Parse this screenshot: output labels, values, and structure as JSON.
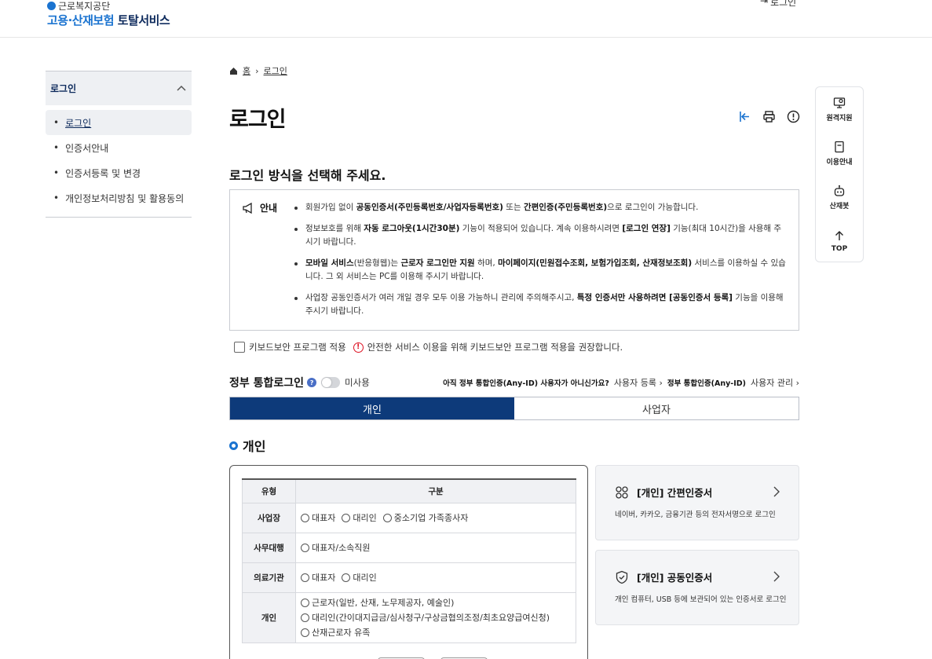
{
  "header": {
    "org": "근로복지공단",
    "brand_a": "고용·산재보험",
    "brand_b": "토탈서비스",
    "logout": "로그인"
  },
  "sidebar": {
    "title": "로그인",
    "items": [
      {
        "label": "로그인"
      },
      {
        "label": "인증서안내"
      },
      {
        "label": "인증서등록 및 변경"
      },
      {
        "label": "개인정보처리방침 및 활용동의"
      }
    ]
  },
  "breadcrumb": [
    "홈",
    "로그인"
  ],
  "page_title": "로그인",
  "section_heading": "로그인 방식을 선택해 주세요.",
  "notice": {
    "label": "안내",
    "items": [
      {
        "parts": [
          {
            "t": "회원가입 없이 ",
            "b": false
          },
          {
            "t": "공동인증서(주민등록번호/사업자등록번호)",
            "b": true
          },
          {
            "t": " 또는 ",
            "b": false
          },
          {
            "t": "간편인증(주민등록번호)",
            "b": true
          },
          {
            "t": "으로 로그인이 가능합니다.",
            "b": false
          }
        ]
      },
      {
        "parts": [
          {
            "t": "정보보호를 위해 ",
            "b": false
          },
          {
            "t": "자동 로그아웃(1시간30분)",
            "b": true
          },
          {
            "t": " 기능이 적용되어 있습니다. 계속 이용하시려면 ",
            "b": false
          },
          {
            "t": "[로그인 연장]",
            "b": true
          },
          {
            "t": " 기능(최대 10시간)을 사용해 주시기 바랍니다.",
            "b": false
          }
        ]
      },
      {
        "parts": [
          {
            "t": "모바일 서비스",
            "b": true
          },
          {
            "t": "(반응형웹)는 ",
            "b": false
          },
          {
            "t": "근로자 로그인만 지원",
            "b": true
          },
          {
            "t": " 하며, ",
            "b": false
          },
          {
            "t": "마이페이지(민원접수조회, 보험가입조회, 산재정보조회)",
            "b": true
          },
          {
            "t": " 서비스를 이용하실 수 있습니다. 그 외 서비스는 PC를 이용해 주시기 바랍니다.",
            "b": false
          }
        ]
      },
      {
        "parts": [
          {
            "t": "사업장 공동인증서가 여러 개일 경우 모두 이용 가능하니 관리에 주의해주시고, ",
            "b": false
          },
          {
            "t": "특정 인증서만 사용하려면 [공동인증서 등록]",
            "b": true
          },
          {
            "t": " 기능을 이용해 주시기 바랍니다.",
            "b": false
          }
        ]
      }
    ]
  },
  "keyboard": {
    "label": "키보드보안 프로그램 적용",
    "warning": "안전한 서비스 이용을 위해 키보드보안 프로그램 적용을 권장합니다."
  },
  "gov_login": {
    "title": "정부 통합로그인",
    "toggle_label": "미사용",
    "question": "아직 정부 통합인증(Any-ID) 사용자가 아니신가요?",
    "register": "사용자 등록",
    "anyid": "정부 통합인증(Any-ID)",
    "manage": "사용자 관리"
  },
  "tabs": [
    "개인",
    "사업자"
  ],
  "sub_heading": "개인",
  "type_table": {
    "headers": [
      "유형",
      "구분"
    ],
    "rows": [
      {
        "cat": "사업장",
        "lines": [
          [
            "대표자",
            "대리인",
            "중소기업 가족종사자"
          ]
        ]
      },
      {
        "cat": "사무대행",
        "lines": [
          [
            "대표자/소속직원"
          ]
        ]
      },
      {
        "cat": "의료기관",
        "lines": [
          [
            "대표자",
            "대리인"
          ]
        ]
      },
      {
        "cat": "개인",
        "lines": [
          [
            "근로자(일반, 산재, 노무제공자, 예술인)"
          ],
          [
            "대리인(간이대지급금/심사청구/구상금협의조정/최초요양급여신청)"
          ],
          [
            "산재근로자 유족"
          ]
        ]
      }
    ]
  },
  "certs": [
    {
      "title": "[개인] 간편인증서",
      "desc": "네이버, 카카오, 금융기관 등의 전자서명으로 로그인",
      "icon": "easy-cert-icon"
    },
    {
      "title": "[개인] 공동인증서",
      "desc": "개인 컴퓨터, USB 등에 보관되어 있는 인증서로 로그인",
      "icon": "shield-check-icon"
    }
  ],
  "quick_menu": [
    "원격지원",
    "이용안내",
    "산재봇",
    "TOP"
  ]
}
